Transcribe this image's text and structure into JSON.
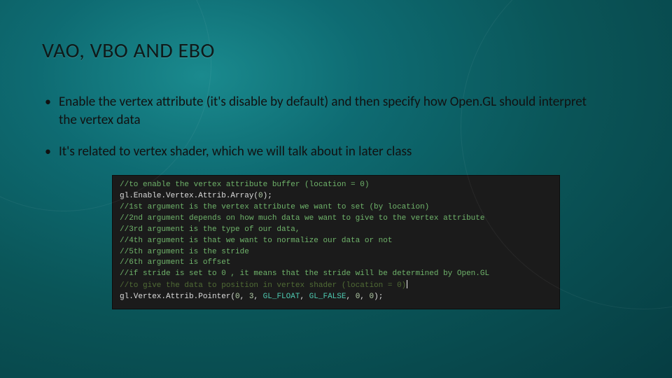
{
  "title": "VAO, VBO AND EBO",
  "bullets": [
    "Enable the vertex attribute (it's disable by default) and then specify how Open.GL should interpret the vertex data",
    "It's related to vertex shader, which we will talk about in later class"
  ],
  "code": {
    "lines": [
      {
        "kind": "comment",
        "text": "//to enable the vertex attribute buffer (location = 0)"
      },
      {
        "kind": "call",
        "text": "gl.Enable.Vertex.Attrib.Array(0);"
      },
      {
        "kind": "comment",
        "text": "//1st argument is the vertex attribute we want to set (by location)"
      },
      {
        "kind": "comment",
        "text": "//2nd argument depends on how much data we want to give to the vertex attribute"
      },
      {
        "kind": "comment",
        "text": "//3rd argument is the type of our data,"
      },
      {
        "kind": "comment",
        "text": "//4th argument is that we want to normalize our data or not"
      },
      {
        "kind": "comment",
        "text": "//5th argument is the stride"
      },
      {
        "kind": "comment",
        "text": "//6th argument is offset"
      },
      {
        "kind": "comment",
        "text": "//if stride is set to 0 , it means that the stride will be determined by Open.GL"
      },
      {
        "kind": "dimcmt",
        "text": "//to give the data to position in vertex shader (location = 0)"
      },
      {
        "kind": "callkw",
        "text": "gl.Vertex.Attrib.Pointer(0, 3, GL_FLOAT, GL_FALSE, 0, 0);"
      }
    ]
  }
}
